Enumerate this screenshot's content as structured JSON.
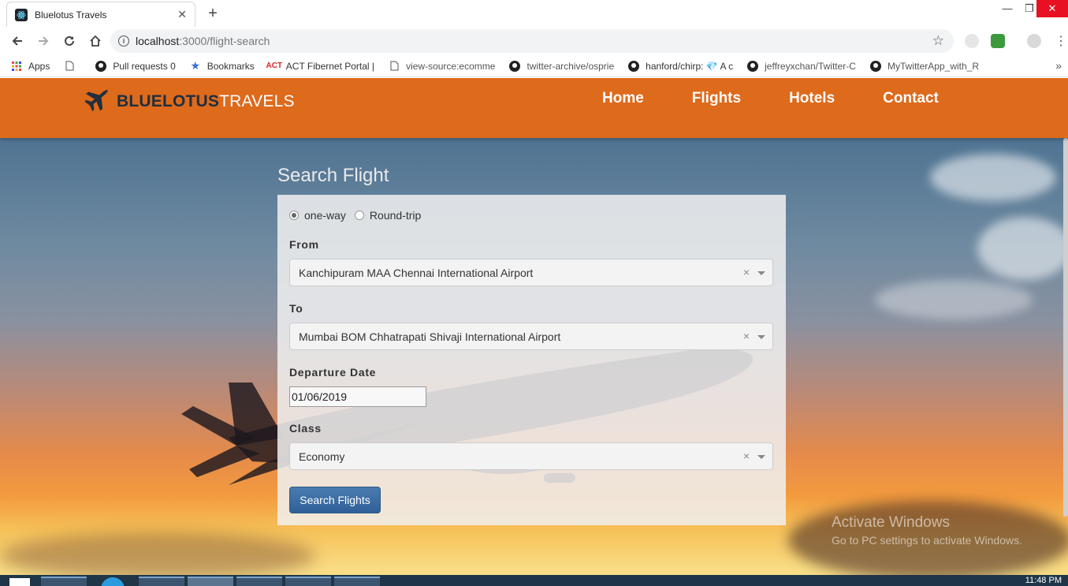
{
  "browser": {
    "tab_title": "Bluelotus Travels",
    "url_host": "localhost",
    "url_path": ":3000/flight-search",
    "bookmarks": [
      "Apps",
      "Pull requests 0",
      "Bookmarks",
      "ACT Fibernet Portal |",
      "view-source:ecomme",
      "twitter-archive/osprie",
      "hanford/chirp: 💎 A c",
      "jeffreyxchan/Twitter-C",
      "MyTwitterApp_with_R"
    ]
  },
  "site": {
    "logo_part1": "BLUELOTUS",
    "logo_part2": "TRAVELS",
    "nav": [
      "Home",
      "Flights",
      "Hotels",
      "Contact"
    ],
    "header_color": "#de6a1c"
  },
  "search": {
    "title": "Search Flight",
    "trip_one_way": "one-way",
    "trip_round": "Round-trip",
    "from_label": "From",
    "from_value": "Kanchipuram MAA Chennai International Airport",
    "to_label": "To",
    "to_value": "Mumbai BOM Chhatrapati Shivaji International Airport",
    "date_label": "Departure Date",
    "date_value": "01/06/2019",
    "class_label": "Class",
    "class_value": "Economy",
    "clear_glyph": "×",
    "submit_label": "Search Flights"
  },
  "watermark": {
    "line1": "Activate Windows",
    "line2": "Go to PC settings to activate Windows."
  },
  "taskbar": {
    "clock": "11:48 PM"
  }
}
